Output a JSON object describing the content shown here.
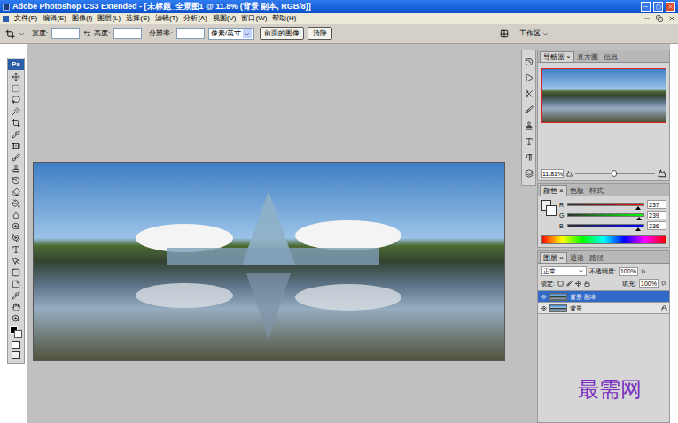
{
  "window": {
    "title": "Adobe Photoshop CS3 Extended - [未标题_全景图1 @ 11.8% (背景 副本, RGB/8)]"
  },
  "menu": [
    "文件(F)",
    "编辑(E)",
    "图像(I)",
    "图层(L)",
    "选择(S)",
    "滤镜(T)",
    "分析(A)",
    "视图(V)",
    "窗口(W)",
    "帮助(H)"
  ],
  "options": {
    "width_label": "宽度:",
    "height_label": "高度:",
    "resolution_label": "分辨率:",
    "unit": "像素/英寸",
    "front_image_button": "前面的图像",
    "clear_button": "清除",
    "workspace": "工作区"
  },
  "toolbox": {
    "logo": "Ps"
  },
  "navigator": {
    "close": "×",
    "tabs": [
      {
        "label": "导航器",
        "selected": true
      },
      {
        "label": "直方图",
        "selected": false
      },
      {
        "label": "信息",
        "selected": false
      }
    ],
    "zoom": "11.81%",
    "zoom_level": 0.45
  },
  "color": {
    "close": "×",
    "tabs": [
      {
        "label": "颜色",
        "selected": true
      },
      {
        "label": "色板",
        "selected": false
      },
      {
        "label": "样式",
        "selected": false
      }
    ],
    "channels": [
      {
        "name": "R",
        "value": "237",
        "level": 0.93,
        "color": "#ff0000"
      },
      {
        "name": "G",
        "value": "239",
        "level": 0.94,
        "color": "#00ff00"
      },
      {
        "name": "B",
        "value": "236",
        "level": 0.93,
        "color": "#0000ff"
      }
    ]
  },
  "layers": {
    "close": "×",
    "tabs": [
      {
        "label": "图层",
        "selected": true
      },
      {
        "label": "通道",
        "selected": false
      },
      {
        "label": "路径",
        "selected": false
      }
    ],
    "blend_mode": "正常",
    "opacity_label": "不透明度:",
    "opacity": "100%",
    "lock_label": "锁定:",
    "fill_label": "填充:",
    "fill": "100%",
    "items": [
      {
        "name": "背景 副本",
        "selected": true,
        "visible": true,
        "locked": false
      },
      {
        "name": "背景",
        "selected": false,
        "visible": true,
        "locked": true
      }
    ]
  },
  "watermark": "最需网"
}
